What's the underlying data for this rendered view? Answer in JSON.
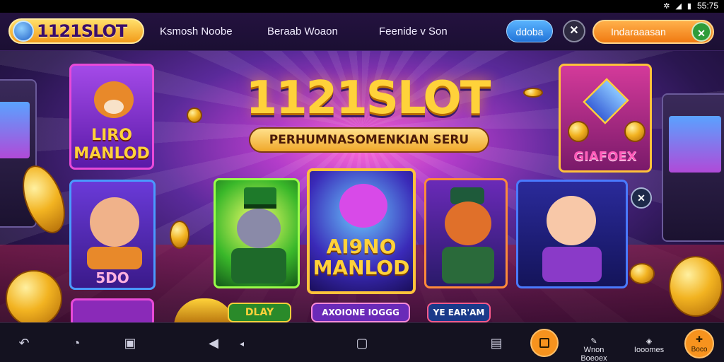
{
  "status_bar": {
    "time": "55:75"
  },
  "nav": {
    "logo_text": "1121SLOT",
    "links": [
      "Ksmosh Noobe",
      "Beraab Woaon",
      "Feenide v Son"
    ],
    "blue_button": "ddoba",
    "close_button": "✕",
    "orange_button": "Indaraaasan",
    "orange_close": "✕"
  },
  "hero": {
    "title": "1121SLOT",
    "subtitle": "PERHUMNASOMENKIAN SERU"
  },
  "cards": {
    "top_left_label": "LIRO\nMANLOD",
    "top_right_label": "GIAFOEX",
    "row": [
      {
        "label": "5DO"
      },
      {
        "label": ""
      },
      {
        "label": "AI9NO\nMANLOD"
      },
      {
        "label": ""
      },
      {
        "label": ""
      }
    ],
    "bottom_labels": [
      "DLAY",
      "AXOIONE IOGGG",
      "YE EAR'AM"
    ]
  },
  "close_small": "✕",
  "bottom_bar": {
    "icons": [
      "back-icon",
      "chat-icon",
      "window-icon",
      "triangle-left-icon",
      "small-triangle-icon",
      "home-square-icon",
      "bag-icon",
      "orange-square-icon",
      "pen-icon",
      "tag-icon",
      "gift-icon"
    ],
    "text_items": [
      "Wnon Boeoex",
      "Iooomes",
      "Boco"
    ]
  },
  "colors": {
    "gold": "#ffd23a",
    "purple_bg": "#2a1650",
    "pink_glow": "#ff6bd6",
    "orange": "#f7931e",
    "blue": "#2274d8"
  }
}
